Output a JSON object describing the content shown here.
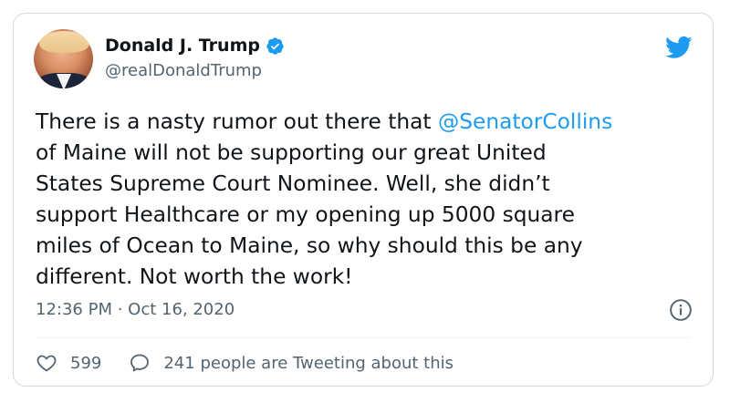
{
  "author": {
    "name": "Donald J. Trump",
    "handle": "@realDonaldTrump",
    "verified": true
  },
  "tweet": {
    "text_before": "There is a nasty rumor out there that ",
    "mention": "@SenatorCollins",
    "text_after": "\nof Maine will not be supporting our great United\nStates Supreme Court Nominee. Well, she didn’t\nsupport Healthcare or my opening up 5000 square\nmiles of Ocean to Maine, so why should this be any\ndifferent. Not worth the work!"
  },
  "meta": {
    "timestamp": "12:36 PM · Oct 16, 2020"
  },
  "actions": {
    "like_count": "599",
    "conversation_label": "241 people are Tweeting about this"
  },
  "icons": {
    "brand": "twitter-bird-icon",
    "verified": "verified-badge-icon",
    "info": "info-icon",
    "like": "heart-icon",
    "reply": "speech-bubble-icon"
  },
  "colors": {
    "accent": "#1d9bf0",
    "text": "#0f1419",
    "muted": "#536471",
    "border": "#cfd9de"
  }
}
